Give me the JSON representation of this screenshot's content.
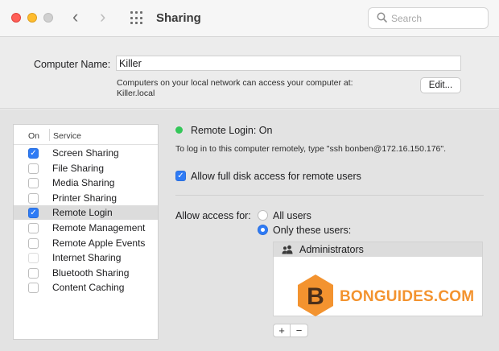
{
  "window": {
    "title": "Sharing",
    "nav_back": "‹",
    "nav_forward": "›",
    "search_placeholder": "Search"
  },
  "computer": {
    "name_label": "Computer Name:",
    "name_value": "Killer",
    "note_line1": "Computers on your local network can access your computer at:",
    "note_line2": "Killer.local",
    "edit_label": "Edit..."
  },
  "services": {
    "header_on": "On",
    "header_service": "Service",
    "items": [
      {
        "label": "Screen Sharing",
        "checked": true
      },
      {
        "label": "File Sharing",
        "checked": false
      },
      {
        "label": "Media Sharing",
        "checked": false
      },
      {
        "label": "Printer Sharing",
        "checked": false
      },
      {
        "label": "Remote Login",
        "checked": true,
        "selected": true
      },
      {
        "label": "Remote Management",
        "checked": false
      },
      {
        "label": "Remote Apple Events",
        "checked": false
      },
      {
        "label": "Internet Sharing",
        "checked": false,
        "disabled": true
      },
      {
        "label": "Bluetooth Sharing",
        "checked": false
      },
      {
        "label": "Content Caching",
        "checked": false
      }
    ]
  },
  "detail": {
    "status": "Remote Login: On",
    "status_color": "#34c759",
    "login_note": "To log in to this computer remotely, type \"ssh bonben@172.16.150.176\".",
    "full_disk_label": "Allow full disk access for remote users",
    "full_disk_checked": true,
    "access_label": "Allow access for:",
    "radio_all": "All users",
    "radio_only": "Only these users:",
    "selected_option": "Only these users:",
    "users": [
      "Administrators"
    ],
    "add_label": "+",
    "remove_label": "−"
  },
  "watermark": {
    "letter": "B",
    "text": "BONGUIDES.COM"
  },
  "colors": {
    "accent": "#2f7bf5",
    "watermark": "#f3932f"
  }
}
